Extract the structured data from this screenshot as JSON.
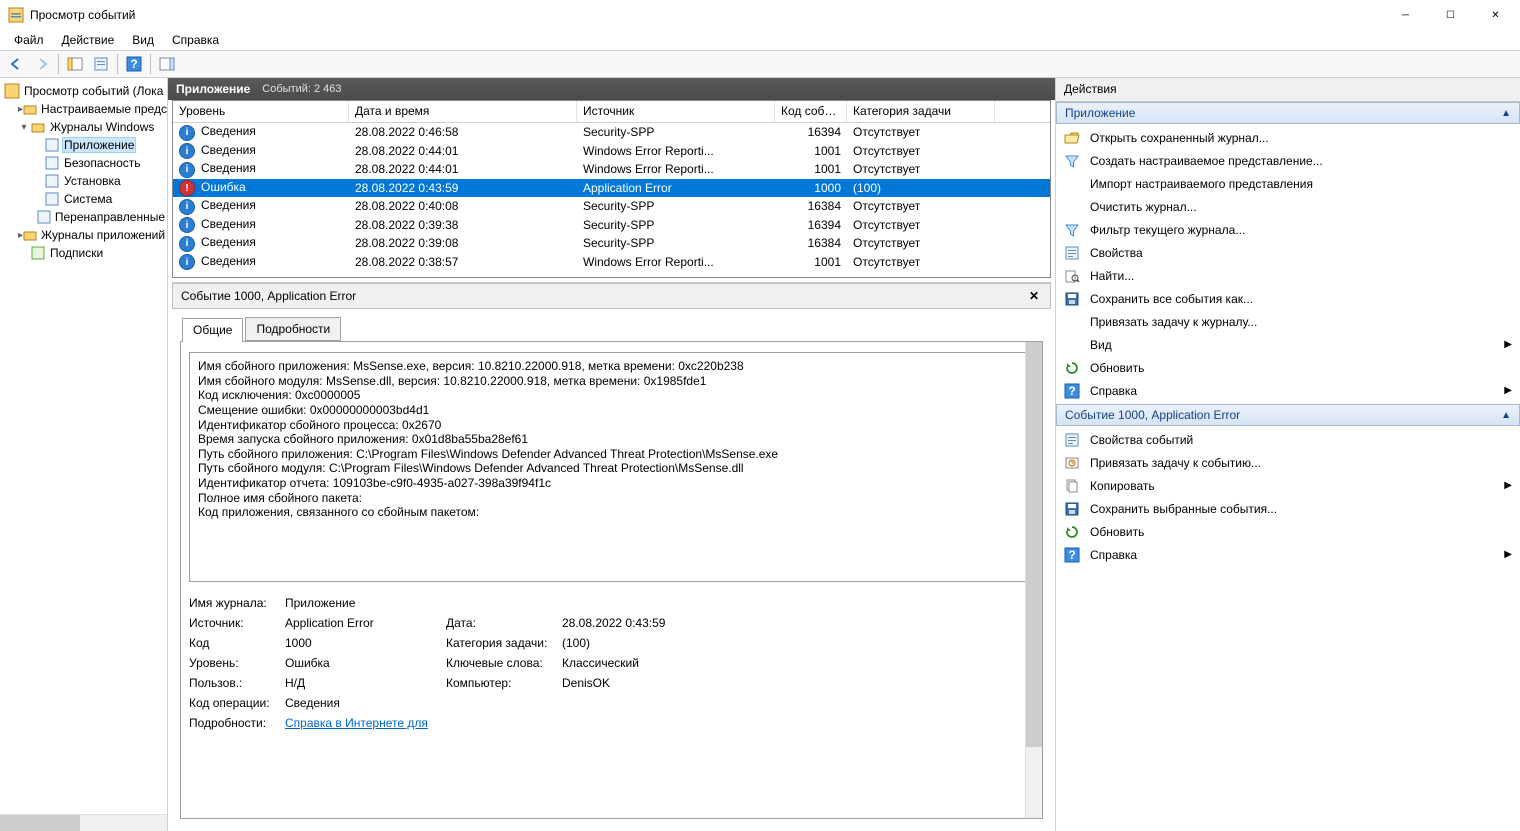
{
  "window": {
    "title": "Просмотр событий"
  },
  "menu": [
    "Файл",
    "Действие",
    "Вид",
    "Справка"
  ],
  "tree": {
    "root": "Просмотр событий (Лока",
    "custom_views": "Настраиваемые предс",
    "win_logs": "Журналы Windows",
    "app": "Приложение",
    "security": "Безопасность",
    "setup": "Установка",
    "system": "Система",
    "forwarded": "Перенаправленные",
    "app_service": "Журналы приложений",
    "subs": "Подписки"
  },
  "list_header": {
    "name": "Приложение",
    "count": "Событий: 2 463"
  },
  "columns": {
    "level": "Уровень",
    "date": "Дата и время",
    "source": "Источник",
    "event_id": "Код события",
    "task": "Категория задачи"
  },
  "events": [
    {
      "lvl": "info",
      "lvl_text": "Сведения",
      "date": "28.08.2022 0:46:58",
      "src": "Security-SPP",
      "id": "16394",
      "task": "Отсутствует"
    },
    {
      "lvl": "info",
      "lvl_text": "Сведения",
      "date": "28.08.2022 0:44:01",
      "src": "Windows Error Reporti...",
      "id": "1001",
      "task": "Отсутствует"
    },
    {
      "lvl": "info",
      "lvl_text": "Сведения",
      "date": "28.08.2022 0:44:01",
      "src": "Windows Error Reporti...",
      "id": "1001",
      "task": "Отсутствует"
    },
    {
      "lvl": "error",
      "lvl_text": "Ошибка",
      "date": "28.08.2022 0:43:59",
      "src": "Application Error",
      "id": "1000",
      "task": "(100)"
    },
    {
      "lvl": "info",
      "lvl_text": "Сведения",
      "date": "28.08.2022 0:40:08",
      "src": "Security-SPP",
      "id": "16384",
      "task": "Отсутствует"
    },
    {
      "lvl": "info",
      "lvl_text": "Сведения",
      "date": "28.08.2022 0:39:38",
      "src": "Security-SPP",
      "id": "16394",
      "task": "Отсутствует"
    },
    {
      "lvl": "info",
      "lvl_text": "Сведения",
      "date": "28.08.2022 0:39:08",
      "src": "Security-SPP",
      "id": "16384",
      "task": "Отсутствует"
    },
    {
      "lvl": "info",
      "lvl_text": "Сведения",
      "date": "28.08.2022 0:38:57",
      "src": "Windows Error Reporti...",
      "id": "1001",
      "task": "Отсутствует"
    }
  ],
  "detail_header": "Событие 1000, Application Error",
  "tabs": {
    "general": "Общие",
    "details": "Подробности"
  },
  "detail_text": "Имя сбойного приложения: MsSense.exe, версия: 10.8210.22000.918, метка времени: 0xc220b238\nИмя сбойного модуля: MsSense.dll, версия: 10.8210.22000.918, метка времени: 0x1985fde1\nКод исключения: 0xc0000005\nСмещение ошибки: 0x00000000003bd4d1\nИдентификатор сбойного процесса: 0x2670\nВремя запуска сбойного приложения: 0x01d8ba55ba28ef61\nПуть сбойного приложения: C:\\Program Files\\Windows Defender Advanced Threat Protection\\MsSense.exe\nПуть сбойного модуля: C:\\Program Files\\Windows Defender Advanced Threat Protection\\MsSense.dll\nИдентификатор отчета: 109103be-c9f0-4935-a027-398a39f94f1c\nПолное имя сбойного пакета:\nКод приложения, связанного со сбойным пакетом:",
  "detail_fields": {
    "log_lbl": "Имя журнала:",
    "log_val": "Приложение",
    "src_lbl": "Источник:",
    "src_val": "Application Error",
    "date_lbl": "Дата:",
    "date_val": "28.08.2022 0:43:59",
    "code_lbl": "Код",
    "code_val": "1000",
    "cat_lbl": "Категория задачи:",
    "cat_val": "(100)",
    "level_lbl": "Уровень:",
    "level_val": "Ошибка",
    "kw_lbl": "Ключевые слова:",
    "kw_val": "Классический",
    "user_lbl": "Пользов.:",
    "user_val": "Н/Д",
    "comp_lbl": "Компьютер:",
    "comp_val": "DenisOK",
    "op_lbl": "Код операции:",
    "op_val": "Сведения",
    "more_lbl": "Подробности:",
    "more_link": "Справка в Интернете для"
  },
  "actions": {
    "header": "Действия",
    "section1": "Приложение",
    "items1": [
      {
        "icon": "folder-open",
        "label": "Открыть сохраненный журнал..."
      },
      {
        "icon": "filter-new",
        "label": "Создать настраиваемое представление..."
      },
      {
        "icon": "none",
        "label": "Импорт настраиваемого представления"
      },
      {
        "icon": "none",
        "label": "Очистить журнал..."
      },
      {
        "icon": "filter",
        "label": "Фильтр текущего журнала..."
      },
      {
        "icon": "props",
        "label": "Свойства"
      },
      {
        "icon": "find",
        "label": "Найти..."
      },
      {
        "icon": "save",
        "label": "Сохранить все события как..."
      },
      {
        "icon": "none",
        "label": "Привязать задачу к журналу..."
      },
      {
        "icon": "none",
        "label": "Вид",
        "sub": true
      },
      {
        "icon": "refresh",
        "label": "Обновить"
      },
      {
        "icon": "help",
        "label": "Справка",
        "sub": true
      }
    ],
    "section2": "Событие 1000, Application Error",
    "items2": [
      {
        "icon": "props",
        "label": "Свойства событий"
      },
      {
        "icon": "task",
        "label": "Привязать задачу к событию..."
      },
      {
        "icon": "copy",
        "label": "Копировать",
        "sub": true
      },
      {
        "icon": "save",
        "label": "Сохранить выбранные события..."
      },
      {
        "icon": "refresh",
        "label": "Обновить"
      },
      {
        "icon": "help",
        "label": "Справка",
        "sub": true
      }
    ]
  }
}
